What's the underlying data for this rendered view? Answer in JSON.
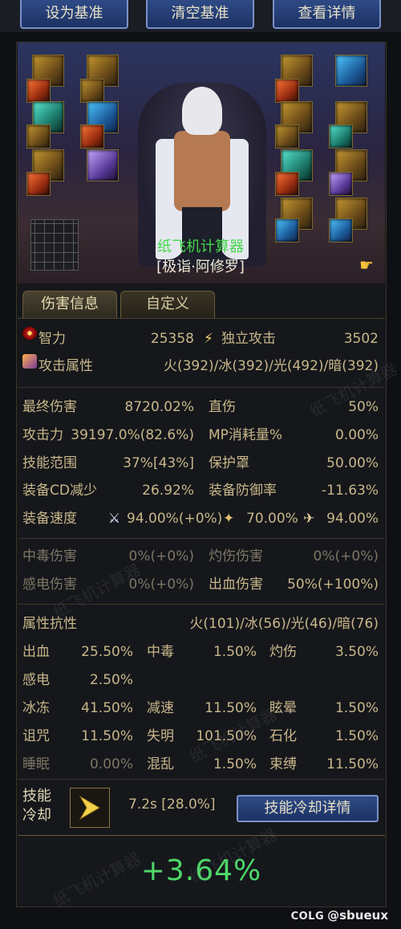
{
  "top_buttons": [
    "设为基准",
    "清空基准",
    "查看详情"
  ],
  "scene": {
    "calc_title": "纸飞机计算器",
    "character_name": "[极诣·阿修罗]"
  },
  "tabs": [
    "伤害信息",
    "自定义"
  ],
  "primary": {
    "int_label": "智力",
    "int_value": "25358",
    "indep_label": "独立攻击",
    "indep_value": "3502",
    "elem_label": "攻击属性",
    "elem_value": "火(392)/冰(392)/光(492)/暗(392)"
  },
  "stats": {
    "final_dmg_label": "最终伤害",
    "final_dmg_value": "8720.02%",
    "crit_label": "直伤",
    "crit_value": "50%",
    "atk_label": "攻击力",
    "atk_value": "39197.0%(82.6%)",
    "mp_label": "MP消耗量%",
    "mp_value": "0.00%",
    "range_label": "技能范围",
    "range_value": "37%[43%]",
    "shield_label": "保护罩",
    "shield_value": "50.00%",
    "cd_label": "装备CD减少",
    "cd_value": "26.92%",
    "def_label": "装备防御率",
    "def_value": "-11.63%",
    "speed_label": "装备速度",
    "speed_atk": "94.00%(+0%)",
    "speed_cast": "70.00%",
    "speed_move": "94.00%"
  },
  "status_dmg": {
    "poison_label": "中毒伤害",
    "poison_value": "0%(+0%)",
    "burn_label": "灼伤伤害",
    "burn_value": "0%(+0%)",
    "shock_label": "感电伤害",
    "shock_value": "0%(+0%)",
    "bleed_label": "出血伤害",
    "bleed_value": "50%(+100%)"
  },
  "resist": {
    "label": "属性抗性",
    "value": "火(101)/冰(56)/光(46)/暗(76)",
    "rows": [
      [
        [
          "出血",
          "25.50%"
        ],
        [
          "中毒",
          "1.50%"
        ],
        [
          "灼伤",
          "3.50%"
        ]
      ],
      [
        [
          "感电",
          "2.50%"
        ]
      ],
      [
        [
          "冰冻",
          "41.50%"
        ],
        [
          "减速",
          "11.50%"
        ],
        [
          "眩晕",
          "1.50%"
        ]
      ],
      [
        [
          "诅咒",
          "11.50%"
        ],
        [
          "失明",
          "101.50%"
        ],
        [
          "石化",
          "1.50%"
        ]
      ],
      [
        [
          "睡眠",
          "0.00%"
        ],
        [
          "混乱",
          "1.50%"
        ],
        [
          "束缚",
          "11.50%"
        ]
      ]
    ]
  },
  "cooldown": {
    "label_line1": "技能",
    "label_line2": "冷却",
    "value": "7.2s [28.0%]",
    "button": "技能冷却详情"
  },
  "result": "+3.64%",
  "watermark_text": "纸飞机计算器",
  "footer": {
    "brand": "COLG",
    "user": "@sbueux"
  }
}
